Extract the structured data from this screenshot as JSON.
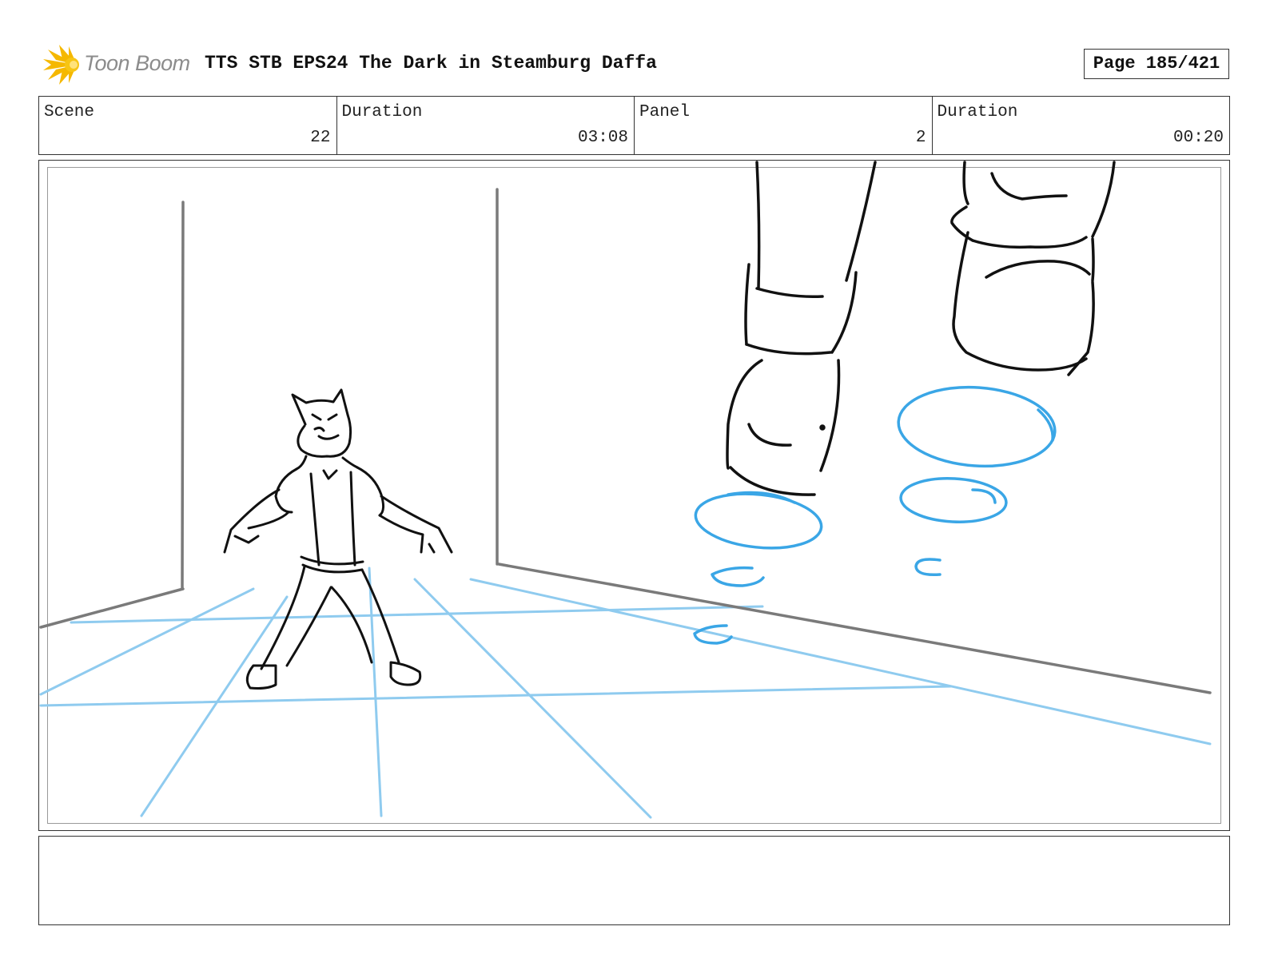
{
  "header": {
    "logo_text": "Toon Boom",
    "title": "TTS STB EPS24 The Dark in Steamburg Daffa",
    "page_label": "Page 185/421"
  },
  "info": {
    "scene_label": "Scene",
    "scene_value": "22",
    "scene_duration_label": "Duration",
    "scene_duration_value": "03:08",
    "panel_label": "Panel",
    "panel_value": "2",
    "panel_duration_label": "Duration",
    "panel_duration_value": "00:20"
  },
  "colors": {
    "logo_yellow": "#f5b800",
    "sketch_black": "#111111",
    "wall_gray": "#7a7a7a",
    "grid_blue": "#8fcbef",
    "motion_blue": "#3aa6e6"
  },
  "notes": {
    "text": ""
  }
}
